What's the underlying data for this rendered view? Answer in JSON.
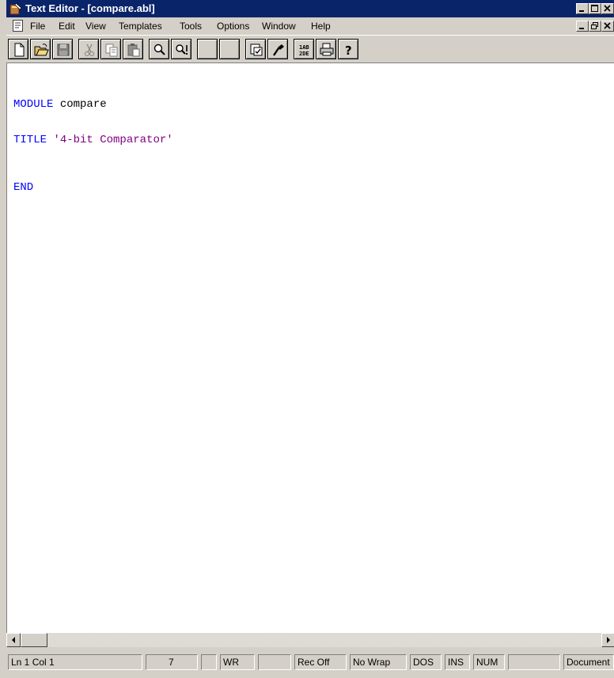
{
  "window": {
    "title": "Text Editor - [compare.abl]",
    "controls": [
      "minimize-icon",
      "restore-icon",
      "close-icon"
    ]
  },
  "menu": {
    "items": [
      "File",
      "Edit",
      "View",
      "Templates",
      "Tools",
      "Options",
      "Window",
      "Help"
    ],
    "doc_controls": [
      "minimize-icon",
      "restore-icon",
      "close-icon"
    ]
  },
  "toolbar": {
    "buttons": [
      "new-file-icon",
      "open-folder-icon",
      "save-icon",
      "cut-icon",
      "copy-icon",
      "paste-icon",
      "find-icon",
      "find-next-icon",
      "blank-button",
      "blank-button",
      "insert-template-icon",
      "syntax-check-icon",
      "compile-abc-icon",
      "print-icon",
      "help-icon"
    ]
  },
  "editor": {
    "lines": [
      {
        "keyword": "MODULE",
        "text": " compare"
      },
      {
        "keyword": "TITLE",
        "string": " '4-bit Comparator'"
      },
      {
        "keyword": "END"
      }
    ],
    "colors": {
      "keyword": "#0000ff",
      "string": "#800080",
      "text": "#000000"
    }
  },
  "status": {
    "position": "Ln 1 Col 1",
    "column_value": "7",
    "mode": "WR",
    "record": "Rec Off",
    "wrap": "No Wrap",
    "format": "DOS",
    "insert": "INS",
    "numlock": "NUM",
    "doc": "Document"
  }
}
